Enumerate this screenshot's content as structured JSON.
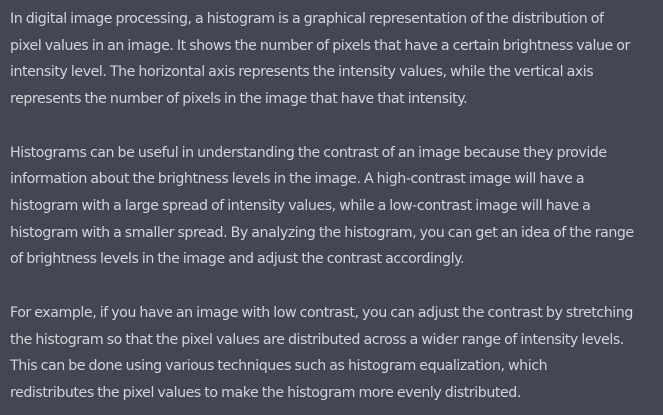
{
  "response": {
    "paragraphs": [
      {
        "lines": [
          "In digital image processing, a histogram is a graphical representation of the distribution of",
          "pixel values in an image. It shows the number of pixels that have a certain brightness value or",
          "intensity level. The horizontal axis represents the intensity values, while the vertical axis",
          "represents the number of pixels in the image that have that intensity."
        ]
      },
      {
        "lines": [
          "Histograms can be useful in understanding the contrast of an image because they provide",
          "information about the brightness levels in the image. A high-contrast image will have a",
          "histogram with a large spread of intensity values, while a low-contrast image will have a",
          "histogram with a smaller spread. By analyzing the histogram, you can get an idea of the range",
          "of brightness levels in the image and adjust the contrast accordingly."
        ]
      },
      {
        "lines": [
          "For example, if you have an image with low contrast, you can adjust the contrast by stretching",
          "the histogram so that the pixel values are distributed across a wider range of intensity levels.",
          "This can be done using various techniques such as histogram equalization, which",
          "redistributes the pixel values to make the histogram more evenly distributed."
        ]
      }
    ]
  },
  "colors": {
    "background": "#444654",
    "text": "#d1d5db"
  }
}
